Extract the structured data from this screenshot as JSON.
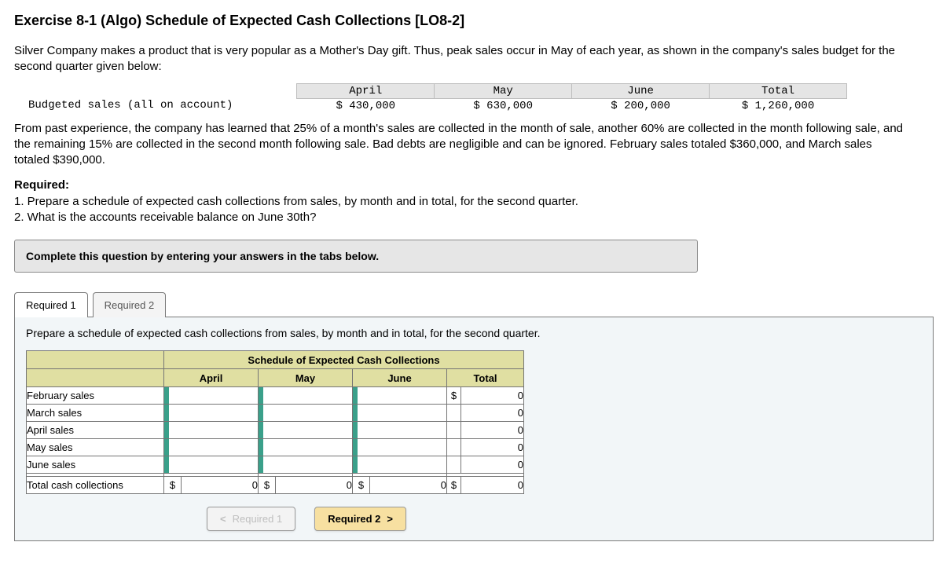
{
  "title": "Exercise 8-1 (Algo) Schedule of Expected Cash Collections [LO8-2]",
  "intro": "Silver Company makes a product that is very popular as a Mother's Day gift. Thus, peak sales occur in May of each year, as shown in the company's sales budget for the second quarter given below:",
  "budget": {
    "row_label": "Budgeted sales (all on account)",
    "columns": [
      "April",
      "May",
      "June",
      "Total"
    ],
    "values": [
      "$ 430,000",
      "$ 630,000",
      "$ 200,000",
      "$ 1,260,000"
    ]
  },
  "explain": "From past experience, the company has learned that 25% of a month's sales are collected in the month of sale, another 60% are collected in the month following sale, and the remaining 15% are collected in the second month following sale. Bad debts are negligible and can be ignored. February sales totaled $360,000, and March sales totaled $390,000.",
  "required": {
    "header": "Required:",
    "items": [
      "1. Prepare a schedule of expected cash collections from sales, by month and in total, for the second quarter.",
      "2. What is the accounts receivable balance on June 30th?"
    ]
  },
  "instruction_banner": "Complete this question by entering your answers in the tabs below.",
  "tabs": {
    "t1": "Required 1",
    "t2": "Required 2"
  },
  "tab_instruction": "Prepare a schedule of expected cash collections from sales, by month and in total, for the second quarter.",
  "schedule": {
    "title": "Schedule of Expected Cash Collections",
    "columns": [
      "April",
      "May",
      "June",
      "Total"
    ],
    "rows": [
      {
        "label": "February sales",
        "april": "",
        "may": "",
        "june": "",
        "total_cur": "$",
        "total": "0"
      },
      {
        "label": "March sales",
        "april": "",
        "may": "",
        "june": "",
        "total_cur": "",
        "total": "0"
      },
      {
        "label": "April sales",
        "april": "",
        "may": "",
        "june": "",
        "total_cur": "",
        "total": "0"
      },
      {
        "label": "May sales",
        "april": "",
        "may": "",
        "june": "",
        "total_cur": "",
        "total": "0"
      },
      {
        "label": "June sales",
        "april": "",
        "may": "",
        "june": "",
        "total_cur": "",
        "total": "0"
      }
    ],
    "total_row": {
      "label": "Total cash collections",
      "april_cur": "$",
      "april": "0",
      "may_cur": "$",
      "may": "0",
      "june_cur": "$",
      "june": "0",
      "total_cur": "$",
      "total": "0"
    }
  },
  "nav": {
    "prev_label": "Required 1",
    "next_label": "Required 2"
  },
  "glyphs": {
    "chev_left": "<",
    "chev_right": ">"
  }
}
